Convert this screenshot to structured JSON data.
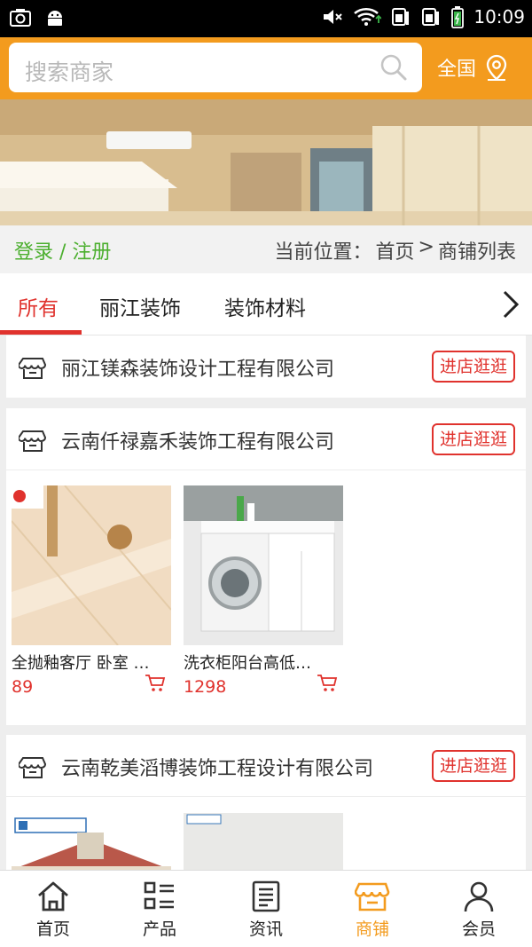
{
  "status_bar": {
    "time": "10:09"
  },
  "search": {
    "placeholder": "搜索商家",
    "region_label": "全国"
  },
  "login": {
    "label": "登录 / 注册"
  },
  "breadcrumb": {
    "prefix": "当前位置：",
    "home": "首页",
    "sep": ">",
    "current": "商铺列表"
  },
  "tabs": [
    {
      "label": "所有",
      "active": true
    },
    {
      "label": "丽江装饰",
      "active": false
    },
    {
      "label": "装饰材料",
      "active": false
    }
  ],
  "stores": [
    {
      "name": "丽江镁森装饰设计工程有限公司",
      "visit_label": "进店逛逛",
      "products": []
    },
    {
      "name": "云南仟禄嘉禾装饰工程有限公司",
      "visit_label": "进店逛逛",
      "products": [
        {
          "name": "全抛釉客厅 卧室 …",
          "price": "89"
        },
        {
          "name": "洗衣柜阳台高低…",
          "price": "1298"
        }
      ]
    },
    {
      "name": "云南乾美滔博装饰工程设计有限公司",
      "visit_label": "进店逛逛",
      "products": []
    }
  ],
  "bottom_nav": [
    {
      "label": "首页",
      "icon": "home-icon",
      "active": false
    },
    {
      "label": "产品",
      "icon": "product-list-icon",
      "active": false
    },
    {
      "label": "资讯",
      "icon": "news-icon",
      "active": false
    },
    {
      "label": "商铺",
      "icon": "store-icon",
      "active": true
    },
    {
      "label": "会员",
      "icon": "member-icon",
      "active": false
    }
  ],
  "colors": {
    "accent": "#f39b1e",
    "red": "#e0322d",
    "green": "#4caf2f"
  }
}
